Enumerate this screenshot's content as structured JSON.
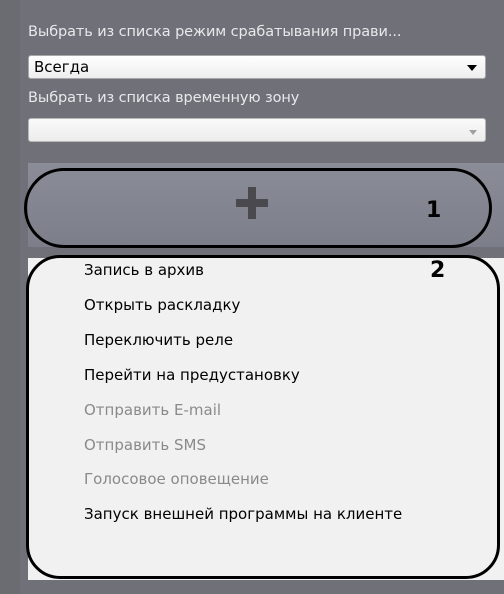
{
  "rule": {
    "mode_label": "Выбрать из списка режим срабатывания прави...",
    "mode_value": "Всегда",
    "timezone_label": "Выбрать из списка временную зону",
    "timezone_value": ""
  },
  "annotations": {
    "callout_1": "1",
    "callout_2": "2"
  },
  "add_button": {
    "icon": "plus-icon"
  },
  "menu": {
    "items": [
      {
        "label": "Запись в архив",
        "enabled": true
      },
      {
        "label": "Открыть раскладку",
        "enabled": true
      },
      {
        "label": "Переключить реле",
        "enabled": true
      },
      {
        "label": "Перейти на предустановку",
        "enabled": true
      },
      {
        "label": "Отправить E-mail",
        "enabled": false
      },
      {
        "label": "Отправить SMS",
        "enabled": false
      },
      {
        "label": "Голосовое оповещение",
        "enabled": false
      },
      {
        "label": "Запуск внешней программы на клиенте",
        "enabled": true
      }
    ]
  },
  "colors": {
    "panel_bg": "#707078",
    "menu_bg": "#f1f1f1",
    "disabled_text": "#8a8a8a",
    "annotation": "#000000"
  }
}
